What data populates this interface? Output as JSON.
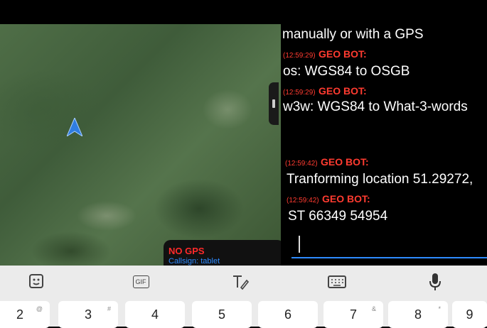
{
  "map": {
    "status": "NO GPS",
    "callsign": "Callsign: tablet"
  },
  "chat": {
    "messages": [
      {
        "text": "manually or with a GPS"
      },
      {
        "time": "(12:59:29)",
        "sender": "GEO BOT:",
        "text": "os: WGS84 to OSGB"
      },
      {
        "time": "(12:59:29)",
        "sender": "GEO BOT:",
        "text": "w3w: WGS84 to What-3-words"
      },
      {
        "time": "(12:59:42)",
        "sender": "GEO BOT:",
        "text": "Tranforming location 51.29272,"
      },
      {
        "time": "(12:59:42)",
        "sender": "GEO BOT:",
        "text": "ST 66349 54954"
      }
    ]
  },
  "keyboard": {
    "gif_label": "GIF",
    "number_keys": [
      "2",
      "3",
      "4",
      "5",
      "6",
      "7",
      "8",
      "9"
    ]
  },
  "colors": {
    "bot_red": "#ff3b30",
    "accent_blue": "#2e8bff",
    "gps_green": "#2ec52e"
  }
}
